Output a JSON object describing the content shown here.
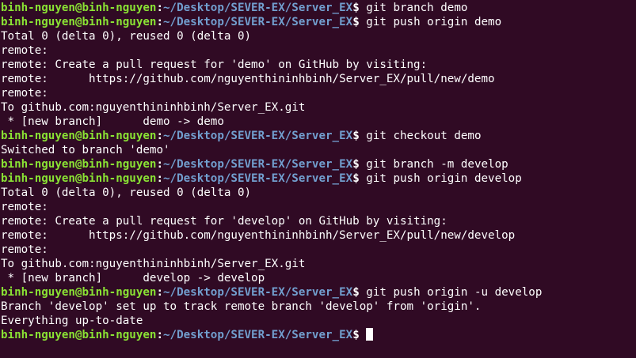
{
  "terminal": {
    "colors": {
      "background": "#300a24",
      "user_host": "#8ae234",
      "path": "#729fcf",
      "text": "#ffffff"
    },
    "lines": [
      {
        "kind": "prompt",
        "user": "binh-nguyen@binh-nguyen",
        "colon": ":",
        "path": "~/Desktop/SEVER-EX/Server_EX",
        "dollar": "$",
        "command": " git branch demo"
      },
      {
        "kind": "prompt",
        "user": "binh-nguyen@binh-nguyen",
        "colon": ":",
        "path": "~/Desktop/SEVER-EX/Server_EX",
        "dollar": "$",
        "command": " git push origin demo"
      },
      {
        "kind": "output",
        "text": "Total 0 (delta 0), reused 0 (delta 0)"
      },
      {
        "kind": "output",
        "text": "remote:"
      },
      {
        "kind": "output",
        "text": "remote: Create a pull request for 'demo' on GitHub by visiting:"
      },
      {
        "kind": "output",
        "text": "remote:      https://github.com/nguyenthininhbinh/Server_EX/pull/new/demo"
      },
      {
        "kind": "output",
        "text": "remote:"
      },
      {
        "kind": "output",
        "text": "To github.com:nguyenthininhbinh/Server_EX.git"
      },
      {
        "kind": "output",
        "text": " * [new branch]      demo -> demo"
      },
      {
        "kind": "prompt",
        "user": "binh-nguyen@binh-nguyen",
        "colon": ":",
        "path": "~/Desktop/SEVER-EX/Server_EX",
        "dollar": "$",
        "command": " git checkout demo"
      },
      {
        "kind": "output",
        "text": "Switched to branch 'demo'"
      },
      {
        "kind": "prompt",
        "user": "binh-nguyen@binh-nguyen",
        "colon": ":",
        "path": "~/Desktop/SEVER-EX/Server_EX",
        "dollar": "$",
        "command": " git branch -m develop"
      },
      {
        "kind": "prompt",
        "user": "binh-nguyen@binh-nguyen",
        "colon": ":",
        "path": "~/Desktop/SEVER-EX/Server_EX",
        "dollar": "$",
        "command": " git push origin develop"
      },
      {
        "kind": "output",
        "text": "Total 0 (delta 0), reused 0 (delta 0)"
      },
      {
        "kind": "output",
        "text": "remote:"
      },
      {
        "kind": "output",
        "text": "remote: Create a pull request for 'develop' on GitHub by visiting:"
      },
      {
        "kind": "output",
        "text": "remote:      https://github.com/nguyenthininhbinh/Server_EX/pull/new/develop"
      },
      {
        "kind": "output",
        "text": "remote:"
      },
      {
        "kind": "output",
        "text": "To github.com:nguyenthininhbinh/Server_EX.git"
      },
      {
        "kind": "output",
        "text": " * [new branch]      develop -> develop"
      },
      {
        "kind": "prompt",
        "user": "binh-nguyen@binh-nguyen",
        "colon": ":",
        "path": "~/Desktop/SEVER-EX/Server_EX",
        "dollar": "$",
        "command": " git push origin -u develop"
      },
      {
        "kind": "output",
        "text": "Branch 'develop' set up to track remote branch 'develop' from 'origin'."
      },
      {
        "kind": "output",
        "text": "Everything up-to-date"
      },
      {
        "kind": "prompt",
        "user": "binh-nguyen@binh-nguyen",
        "colon": ":",
        "path": "~/Desktop/SEVER-EX/Server_EX",
        "dollar": "$",
        "command": " ",
        "cursor": true
      }
    ]
  }
}
